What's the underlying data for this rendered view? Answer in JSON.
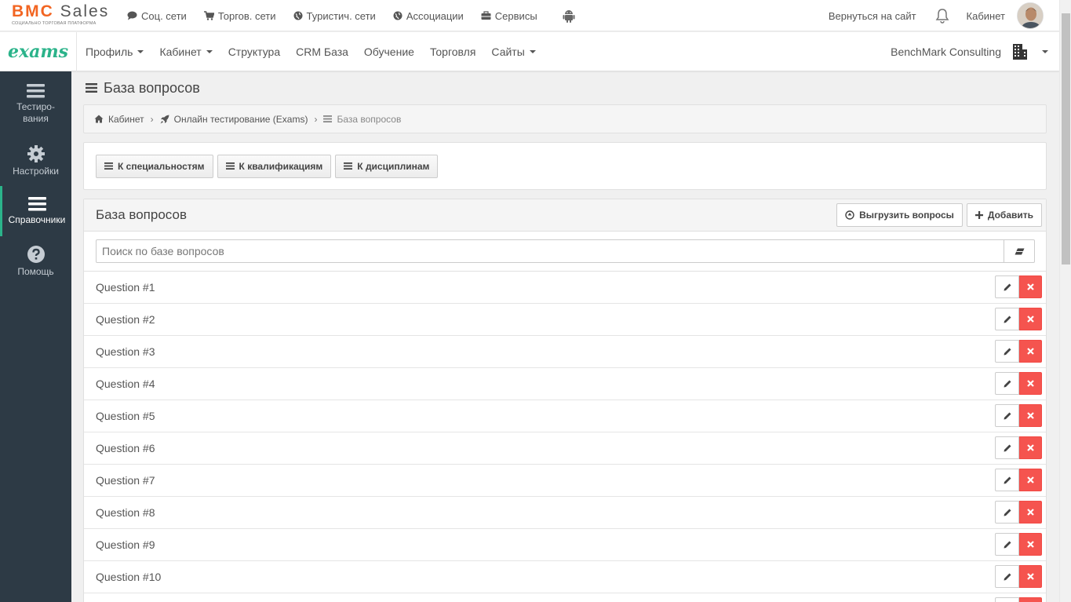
{
  "topbar": {
    "logo_main_a": "BMC",
    "logo_main_b": "Sales",
    "logo_sub": "СОЦИАЛЬНО ТОРГОВАЯ ПЛАТФОРМА",
    "links": [
      {
        "label": "Соц. сети",
        "icon": "chat-icon"
      },
      {
        "label": "Торгов. сети",
        "icon": "cart-icon"
      },
      {
        "label": "Туристич. сети",
        "icon": "globe-icon"
      },
      {
        "label": "Ассоциации",
        "icon": "globe-icon"
      },
      {
        "label": "Сервисы",
        "icon": "briefcase-icon"
      }
    ],
    "back_label": "Вернуться на сайт",
    "cabinet_label": "Кабинет"
  },
  "mainnav": {
    "logo": "exams",
    "items": [
      {
        "label": "Профиль",
        "dropdown": true
      },
      {
        "label": "Кабинет",
        "dropdown": true
      },
      {
        "label": "Структура",
        "dropdown": false
      },
      {
        "label": "CRM База",
        "dropdown": false
      },
      {
        "label": "Обучение",
        "dropdown": false
      },
      {
        "label": "Торговля",
        "dropdown": false
      },
      {
        "label": "Сайты",
        "dropdown": true
      }
    ],
    "company": "BenchMark Consulting"
  },
  "sidebar": {
    "items": [
      {
        "label": "Тестиро-\nвания",
        "icon": "list-icon",
        "active": false
      },
      {
        "label": "Настройки",
        "icon": "gear-icon",
        "active": false
      },
      {
        "label": "Справочники",
        "icon": "list-icon",
        "active": true
      },
      {
        "label": "Помощь",
        "icon": "question-icon",
        "active": false
      }
    ]
  },
  "page": {
    "title": "База вопросов"
  },
  "breadcrumb": {
    "items": [
      "Кабинет",
      "Онлайн тестирование (Exams)",
      "База вопросов"
    ]
  },
  "nav_buttons": {
    "specialties": "К специальностям",
    "qualifications": "К квалификациям",
    "disciplines": "К дисциплинам"
  },
  "list": {
    "title": "База вопросов",
    "export_label": "Выгрузить вопросы",
    "add_label": "Добавить",
    "search_placeholder": "Поиск по базе вопросов",
    "questions": [
      "Question #1",
      "Question #2",
      "Question #3",
      "Question #4",
      "Question #5",
      "Question #6",
      "Question #7",
      "Question #8",
      "Question #9",
      "Question #10",
      ""
    ]
  },
  "colors": {
    "brand_orange": "#f26522",
    "exams_green": "#2bb38a",
    "sidebar_bg": "#2d3a45",
    "delete_red": "#f5544f"
  }
}
